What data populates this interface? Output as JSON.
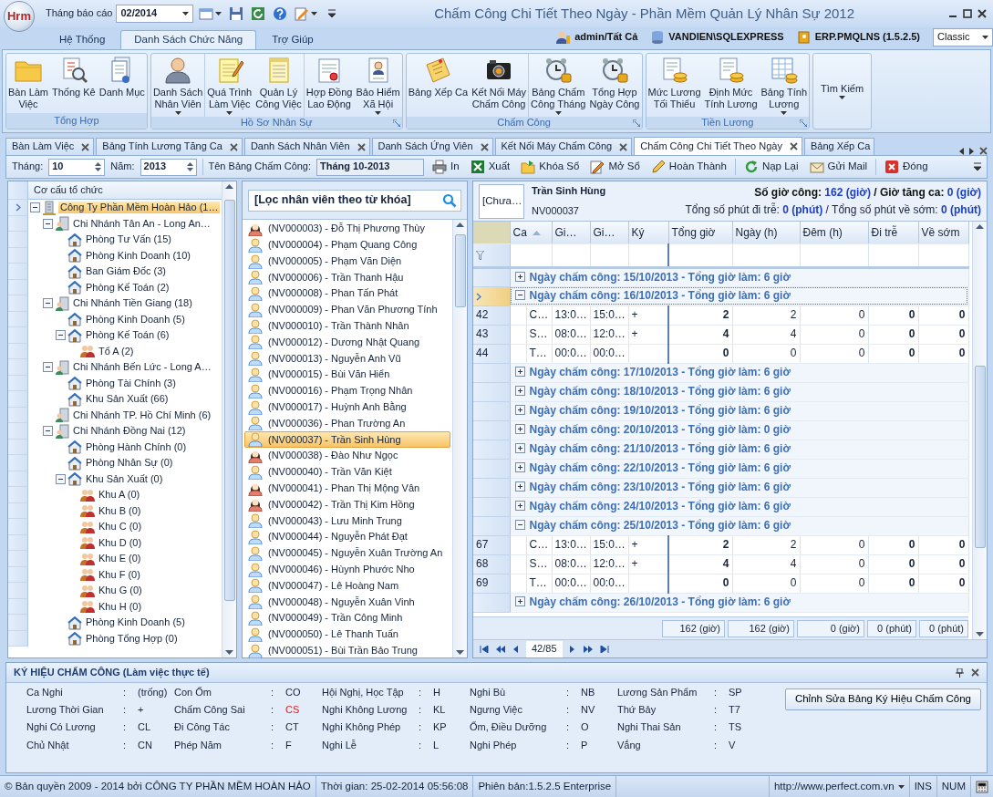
{
  "window": {
    "logo": "Hrm",
    "title": "Chấm Công Chi Tiết Theo Ngày - Phần Mềm Quản Lý Nhân Sự 2012",
    "report_month_label": "Tháng báo cáo",
    "report_month": "02/2014"
  },
  "ribbon_tabs": [
    {
      "label": "Hệ Thống",
      "selected": false
    },
    {
      "label": "Danh Sách Chức Năng",
      "selected": true
    },
    {
      "label": "Trợ Giúp",
      "selected": false
    }
  ],
  "session": {
    "user": "admin/Tất Cả",
    "server": "VANDIEN\\SQLEXPRESS",
    "database": "ERP.PMQLNS (1.5.2.5)",
    "theme": "Classic"
  },
  "ribbon_groups": [
    {
      "label": "Tổng Hợp",
      "launcher": false,
      "buttons": [
        {
          "label": "Bàn Làm\nViệc",
          "kind": "folder",
          "dropdown": false
        },
        {
          "label": "Thống Kê",
          "kind": "document-search",
          "dropdown": false
        },
        {
          "label": "Danh Mục",
          "kind": "documents",
          "dropdown": false
        }
      ]
    },
    {
      "label": "Hồ Sơ Nhân Sự",
      "launcher": true,
      "buttons": [
        {
          "label": "Danh Sách\nNhân Viên",
          "kind": "person",
          "dropdown": true
        },
        {
          "label": "Quá Trình\nLàm Việc",
          "kind": "notepad",
          "dropdown": true
        },
        {
          "label": "Quản Lý\nCông Việc",
          "kind": "lined-paper",
          "dropdown": false
        },
        {
          "label": "Hợp Đồng\nLao Động",
          "kind": "certificate",
          "dropdown": false
        },
        {
          "label": "Bảo Hiểm\nXã Hội",
          "kind": "id-card",
          "dropdown": true
        }
      ]
    },
    {
      "label": "Chấm Công",
      "launcher": true,
      "buttons": [
        {
          "label": "Bảng Xếp Ca",
          "kind": "note",
          "dropdown": false
        },
        {
          "label": "Kết Nối Máy\nChấm Công",
          "kind": "camera",
          "dropdown": false
        },
        {
          "label": "Bảng Chấm\nCông Tháng",
          "kind": "clock",
          "dropdown": true
        },
        {
          "label": "Tổng Hợp\nNgày Công",
          "kind": "clock",
          "dropdown": false
        }
      ]
    },
    {
      "label": "Tiền Lương",
      "launcher": true,
      "buttons": [
        {
          "label": "Mức Lương\nTối Thiểu",
          "kind": "coins-document",
          "dropdown": false
        },
        {
          "label": "Định Mức\nTính Lương",
          "kind": "coins-document",
          "dropdown": false
        },
        {
          "label": "Bảng Tính\nLương",
          "kind": "coins-table",
          "dropdown": true
        }
      ]
    },
    {
      "buttons": [
        {
          "label": "Tìm Kiếm",
          "kind": "plain",
          "dropdown": true
        }
      ]
    }
  ],
  "doc_tabs": [
    {
      "label": "Bàn Làm Việc",
      "selected": false
    },
    {
      "label": "Bảng Tính Lương Tăng Ca",
      "selected": false
    },
    {
      "label": "Danh Sách Nhân Viên",
      "selected": false
    },
    {
      "label": "Danh Sách Ứng Viên",
      "selected": false
    },
    {
      "label": "Kết Nối Máy Chấm Công",
      "selected": false
    },
    {
      "label": "Chấm Công Chi Tiết Theo Ngày",
      "selected": true
    },
    {
      "label": "Bảng Xếp Ca",
      "selected": false
    }
  ],
  "toolbar": {
    "month_label": "Tháng:",
    "month": "10",
    "year_label": "Năm:",
    "year": "2013",
    "sheet_label": "Tên Bảng Chấm Công:",
    "sheet": "Tháng 10-2013",
    "actions": [
      {
        "label": "In",
        "kind": "printer"
      },
      {
        "label": "Xuất",
        "kind": "spreadsheet"
      },
      {
        "label": "Khóa Sổ",
        "kind": "folder"
      },
      {
        "label": "Mở Sổ",
        "kind": "edit"
      },
      {
        "label": "Hoàn Thành",
        "kind": "pencil"
      },
      {
        "label": "Nạp Lại",
        "kind": "refresh"
      },
      {
        "label": "Gửi Mail",
        "kind": "mail"
      },
      {
        "label": "Đóng",
        "kind": "close"
      }
    ]
  },
  "org_tree": {
    "header": "Cơ cấu tổ chức",
    "root": {
      "label": "Công Ty Phần Mềm Hoàn Hảo (1…",
      "kind": "company",
      "expanded": true,
      "selected": true,
      "children": [
        {
          "label": "Chi Nhánh Tân An - Long An…",
          "kind": "branch",
          "expanded": true,
          "selected": false,
          "children": [
            {
              "label": "Phòng Tư Vấn (15)",
              "kind": "department",
              "selected": false
            },
            {
              "label": "Phòng Kinh Doanh (10)",
              "kind": "department",
              "selected": false
            },
            {
              "label": "Ban Giám Đốc (3)",
              "kind": "department",
              "selected": false
            },
            {
              "label": "Phòng Kế Toán (2)",
              "kind": "department",
              "selected": false
            }
          ]
        },
        {
          "label": "Chi Nhánh Tiền Giang (18)",
          "kind": "branch",
          "expanded": true,
          "selected": false,
          "children": [
            {
              "label": "Phòng Kinh Doanh (5)",
              "kind": "department",
              "selected": false
            },
            {
              "label": "Phòng Kế Toán (6)",
              "kind": "department",
              "expanded": true,
              "selected": false,
              "children": [
                {
                  "label": "Tổ A (2)",
                  "kind": "team",
                  "selected": false
                }
              ]
            }
          ]
        },
        {
          "label": "Chi Nhánh Bến Lức - Long A…",
          "kind": "branch",
          "expanded": true,
          "selected": false,
          "children": [
            {
              "label": "Phòng Tài Chính (3)",
              "kind": "department",
              "selected": false
            },
            {
              "label": "Khu Sản Xuất (66)",
              "kind": "department",
              "selected": false
            }
          ]
        },
        {
          "label": "Chi Nhánh TP. Hồ Chí Minh (6)",
          "kind": "branch",
          "selected": false
        },
        {
          "label": "Chi Nhánh Đồng Nai (12)",
          "kind": "branch",
          "expanded": true,
          "selected": false,
          "children": [
            {
              "label": "Phòng Hành Chính (0)",
              "kind": "department",
              "selected": false
            },
            {
              "label": "Phòng Nhân Sự (0)",
              "kind": "department",
              "selected": false
            },
            {
              "label": "Khu Sản Xuất (0)",
              "kind": "department",
              "expanded": true,
              "selected": false,
              "children": [
                {
                  "label": "Khu A (0)",
                  "kind": "team",
                  "selected": false
                },
                {
                  "label": "Khu B (0)",
                  "kind": "team",
                  "selected": false
                },
                {
                  "label": "Khu C (0)",
                  "kind": "team",
                  "selected": false
                },
                {
                  "label": "Khu D (0)",
                  "kind": "team",
                  "selected": false
                },
                {
                  "label": "Khu E (0)",
                  "kind": "team",
                  "selected": false
                },
                {
                  "label": "Khu F (0)",
                  "kind": "team",
                  "selected": false
                },
                {
                  "label": "Khu G (0)",
                  "kind": "team",
                  "selected": false
                },
                {
                  "label": "Khu H (0)",
                  "kind": "team",
                  "selected": false
                }
              ]
            },
            {
              "label": "Phòng Kinh Doanh (5)",
              "kind": "department",
              "selected": false
            },
            {
              "label": "Phòng Tổng Hợp (0)",
              "kind": "department",
              "selected": false
            }
          ]
        }
      ]
    }
  },
  "employees": {
    "filter_placeholder": "[Lọc nhân viên theo từ khóa]",
    "items": [
      {
        "label": "(NV000003) - Đỗ Thị Phương Thùy",
        "kind": "female",
        "selected": false
      },
      {
        "label": "(NV000004) - Phạm Quang Công",
        "kind": "male",
        "selected": false
      },
      {
        "label": "(NV000005) - Phạm Văn Diện",
        "kind": "male",
        "selected": false
      },
      {
        "label": "(NV000006) - Trần Thanh Hậu",
        "kind": "male",
        "selected": false
      },
      {
        "label": "(NV000008) - Phan Tấn Phát",
        "kind": "male",
        "selected": false
      },
      {
        "label": "(NV000009) - Phan Văn Phương Tính",
        "kind": "male",
        "selected": false
      },
      {
        "label": "(NV000010) - Trần Thành Nhân",
        "kind": "male",
        "selected": false
      },
      {
        "label": "(NV000012) - Dương Nhật Quang",
        "kind": "male",
        "selected": false
      },
      {
        "label": "(NV000013) - Nguyễn Anh Vũ",
        "kind": "male",
        "selected": false
      },
      {
        "label": "(NV000015) - Bùi Văn Hiển",
        "kind": "male",
        "selected": false
      },
      {
        "label": "(NV000016) - Phạm Trọng Nhân",
        "kind": "male",
        "selected": false
      },
      {
        "label": "(NV000017) - Huỳnh Anh Bằng",
        "kind": "male",
        "selected": false
      },
      {
        "label": "(NV000036) - Phan Trường An",
        "kind": "male",
        "selected": false
      },
      {
        "label": "(NV000037) - Trần Sinh Hùng",
        "kind": "male",
        "selected": true
      },
      {
        "label": "(NV000038) - Đào Như Ngọc",
        "kind": "female",
        "selected": false
      },
      {
        "label": "(NV000040) - Trần Văn Kiệt",
        "kind": "male",
        "selected": false
      },
      {
        "label": "(NV000041) - Phan Thị Mộng Vân",
        "kind": "female",
        "selected": false
      },
      {
        "label": "(NV000042) - Trần Thị Kim Hồng",
        "kind": "female",
        "selected": false
      },
      {
        "label": "(NV000043) - Lưu Minh Trung",
        "kind": "male",
        "selected": false
      },
      {
        "label": "(NV000044) - Nguyễn Phát Đạt",
        "kind": "male",
        "selected": false
      },
      {
        "label": "(NV000045) - Nguyễn Xuân Trường  An",
        "kind": "male",
        "selected": false
      },
      {
        "label": "(NV000046) - Hùynh Phước Nho",
        "kind": "male",
        "selected": false
      },
      {
        "label": "(NV000047) - Lê Hoàng Nam",
        "kind": "male",
        "selected": false
      },
      {
        "label": "(NV000048) - Nguyễn Xuân Vinh",
        "kind": "male",
        "selected": false
      },
      {
        "label": "(NV000049) - Trần Công Minh",
        "kind": "male",
        "selected": false
      },
      {
        "label": "(NV000050) - Lê Thanh Tuấn",
        "kind": "male",
        "selected": false
      },
      {
        "label": "(NV000051) - Bùi Trần Bảo Trung",
        "kind": "male",
        "selected": false
      }
    ]
  },
  "detail": {
    "photo": "[Chưa…",
    "name": "Trần Sinh Hùng",
    "code": "NV000037",
    "hours_label": "Số giờ công:",
    "hours": "162 (giờ)",
    "overtime_label": "/ Giờ tăng ca:",
    "overtime": "0 (giờ)",
    "late_label": "Tổng số phút đi trễ:",
    "late": "0 (phút)",
    "early_label": "/ Tổng số phút về sớm:",
    "early": "0 (phút)"
  },
  "grid": {
    "columns": [
      {
        "label": "Ca",
        "sorted": true,
        "bold": false
      },
      {
        "label": "Gi…",
        "sorted": false,
        "bold": false
      },
      {
        "label": "Gi…",
        "sorted": false,
        "bold": false
      },
      {
        "label": "Ký",
        "sorted": false,
        "bold": false
      },
      {
        "label": "Tổng giờ",
        "sorted": false,
        "bold": true
      },
      {
        "label": "Ngày (h)",
        "sorted": false,
        "bold": false
      },
      {
        "label": "Đêm (h)",
        "sorted": false,
        "bold": false
      },
      {
        "label": "Đi trễ",
        "sorted": false,
        "bold": true
      },
      {
        "label": "Về sớm",
        "sorted": false,
        "bold": true
      }
    ],
    "rows": [
      {
        "kind": "group",
        "label": "Ngày chấm công: 15/10/2013 - Tổng giờ làm: 6 giờ",
        "expanded": false,
        "selected": false
      },
      {
        "kind": "group",
        "label": "Ngày chấm công: 16/10/2013 - Tổng giờ làm: 6 giờ",
        "expanded": true,
        "selected": true
      },
      {
        "kind": "data",
        "number": "42",
        "cells": [
          "C…",
          "13:0…",
          "15:0…",
          "+",
          "2",
          "2",
          "0",
          "0",
          "0"
        ],
        "selected": false
      },
      {
        "kind": "data",
        "number": "43",
        "cells": [
          "S…",
          "08:0…",
          "12:0…",
          "+",
          "4",
          "4",
          "0",
          "0",
          "0"
        ],
        "selected": false
      },
      {
        "kind": "total",
        "number": "44",
        "cells": [
          "T…",
          "00:0…",
          "00:0…",
          null,
          "0",
          "0",
          "0",
          "0",
          "0"
        ],
        "selected": false
      },
      {
        "kind": "group",
        "label": "Ngày chấm công: 17/10/2013 - Tổng giờ làm: 6 giờ",
        "expanded": false,
        "selected": false
      },
      {
        "kind": "group",
        "label": "Ngày chấm công: 18/10/2013 - Tổng giờ làm: 6 giờ",
        "expanded": false,
        "selected": false
      },
      {
        "kind": "group",
        "label": "Ngày chấm công: 19/10/2013 - Tổng giờ làm: 6 giờ",
        "expanded": false,
        "selected": false
      },
      {
        "kind": "group",
        "label": "Ngày chấm công: 20/10/2013 - Tổng giờ làm: 0 giờ",
        "expanded": false,
        "selected": false
      },
      {
        "kind": "group",
        "label": "Ngày chấm công: 21/10/2013 - Tổng giờ làm: 6 giờ",
        "expanded": false,
        "selected": false
      },
      {
        "kind": "group",
        "label": "Ngày chấm công: 22/10/2013 - Tổng giờ làm: 6 giờ",
        "expanded": false,
        "selected": false
      },
      {
        "kind": "group",
        "label": "Ngày chấm công: 23/10/2013 - Tổng giờ làm: 6 giờ",
        "expanded": false,
        "selected": false
      },
      {
        "kind": "group",
        "label": "Ngày chấm công: 24/10/2013 - Tổng giờ làm: 6 giờ",
        "expanded": false,
        "selected": false
      },
      {
        "kind": "group",
        "label": "Ngày chấm công: 25/10/2013 - Tổng giờ làm: 6 giờ",
        "expanded": true,
        "selected": false
      },
      {
        "kind": "data",
        "number": "67",
        "cells": [
          "C…",
          "13:0…",
          "15:0…",
          "+",
          "2",
          "2",
          "0",
          "0",
          "0"
        ],
        "selected": false
      },
      {
        "kind": "data",
        "number": "68",
        "cells": [
          "S…",
          "08:0…",
          "12:0…",
          "+",
          "4",
          "4",
          "0",
          "0",
          "0"
        ],
        "selected": false
      },
      {
        "kind": "total",
        "number": "69",
        "cells": [
          "T…",
          "00:0…",
          "00:0…",
          null,
          "0",
          "0",
          "0",
          "0",
          "0"
        ],
        "selected": false
      },
      {
        "kind": "group",
        "label": "Ngày chấm công: 26/10/2013 - Tổng giờ làm: 6 giờ",
        "expanded": false,
        "selected": false
      }
    ],
    "totals": [
      "162 (giờ)",
      "162 (giờ)",
      "0 (giờ)",
      "0 (phút)",
      "0 (phút)"
    ],
    "pager": "42/85"
  },
  "legend": {
    "title": "KÝ HIỆU CHẤM CÔNG (Làm việc thực tế)",
    "edit_button": "Chỉnh Sửa Bảng Ký Hiệu Chấm Công",
    "items": [
      {
        "name": "Ca Nghi",
        "sep": ":",
        "code": "(trống)",
        "highlighted": false
      },
      {
        "name": "Con Ốm",
        "sep": ":",
        "code": "CO",
        "highlighted": false
      },
      {
        "name": "Hội Nghị, Học Tập",
        "sep": ":",
        "code": "H",
        "highlighted": false
      },
      {
        "name": "Nghi Bù",
        "sep": ":",
        "code": "NB",
        "highlighted": false
      },
      {
        "name": "Lương Sản Phẩm",
        "sep": ":",
        "code": "SP",
        "highlighted": false
      },
      {
        "name": "Lương Thời Gian",
        "sep": ":",
        "code": "+",
        "highlighted": false
      },
      {
        "name": "Chấm Công Sai",
        "sep": ":",
        "code": "CS",
        "highlighted": true
      },
      {
        "name": "Nghi Không Lương",
        "sep": ":",
        "code": "KL",
        "highlighted": false
      },
      {
        "name": "Ngưng Việc",
        "sep": ":",
        "code": "NV",
        "highlighted": false
      },
      {
        "name": "Thứ Bảy",
        "sep": ":",
        "code": "T7",
        "highlighted": false
      },
      {
        "name": "Nghi Có Lương",
        "sep": ":",
        "code": "CL",
        "highlighted": false
      },
      {
        "name": "Đi Công Tác",
        "sep": ":",
        "code": "CT",
        "highlighted": false
      },
      {
        "name": "Nghi Không Phép",
        "sep": ":",
        "code": "KP",
        "highlighted": false
      },
      {
        "name": "Ốm, Điều Dưỡng",
        "sep": ":",
        "code": "O",
        "highlighted": false
      },
      {
        "name": "Nghi Thai Sản",
        "sep": ":",
        "code": "TS",
        "highlighted": false
      },
      {
        "name": "Chủ Nhật",
        "sep": ":",
        "code": "CN",
        "highlighted": false
      },
      {
        "name": "Phép Năm",
        "sep": ":",
        "code": "F",
        "highlighted": false
      },
      {
        "name": "Nghi Lễ",
        "sep": ":",
        "code": "L",
        "highlighted": false
      },
      {
        "name": "Nghi Phép",
        "sep": ":",
        "code": "P",
        "highlighted": false
      },
      {
        "name": "Vắng",
        "sep": ":",
        "code": "V",
        "highlighted": false
      }
    ]
  },
  "status_bar": {
    "copyright": "© Bản quyền 2009 - 2014 bởi CÔNG TY PHẦN MỀM HOÀN HẢO",
    "time": "Thời gian: 25-02-2014 05:56:08",
    "version": "Phiên bản:1.5.2.5 Enterprise",
    "website": "http://www.perfect.com.vn",
    "ins": "INS",
    "num": "NUM"
  }
}
